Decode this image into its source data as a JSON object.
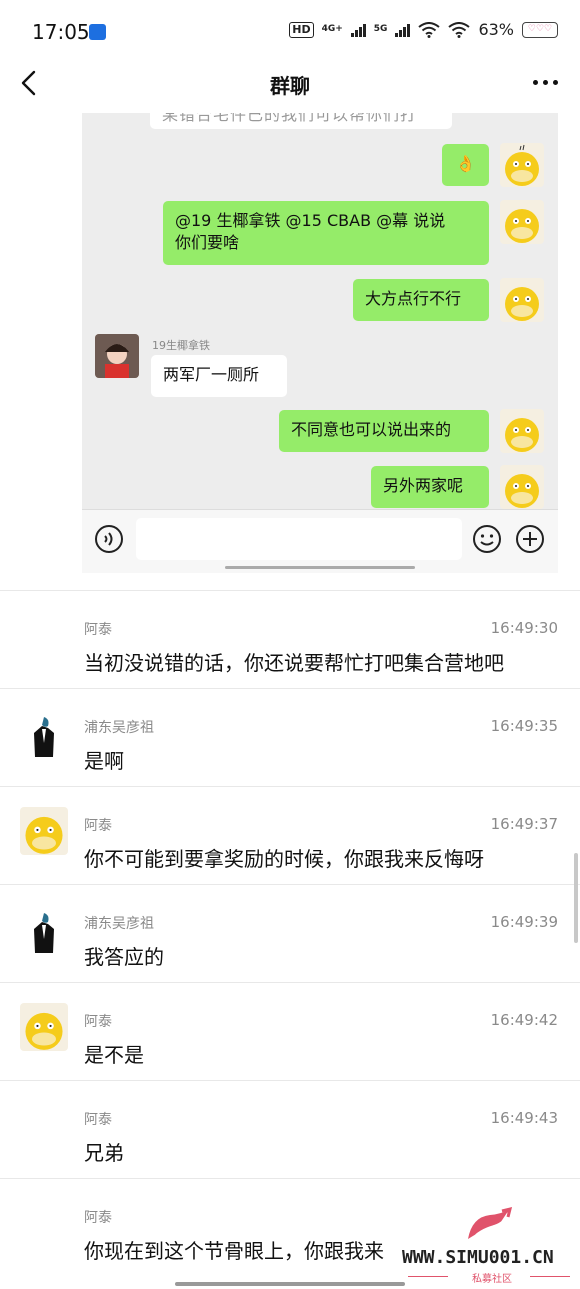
{
  "status_bar": {
    "time": "17:05",
    "hd": "HD",
    "net1": "4G+",
    "net2": "5G",
    "battery_pct": "63%",
    "battery_glyph": "♡♡♡"
  },
  "nav": {
    "title": "群聊"
  },
  "embedded_chat": {
    "cut_text": "某错合宅件已的我们可以帮你们打",
    "messages": [
      {
        "side": "right",
        "text": "👌"
      },
      {
        "side": "right",
        "text_line1": "@19 生椰拿铁  @15 CBAB @幕  说说",
        "text_line2": "你们要啥"
      },
      {
        "side": "right",
        "text": "大方点行不行"
      },
      {
        "side": "left",
        "sender": "19生椰拿铁",
        "text": "两军厂一厕所"
      },
      {
        "side": "right",
        "text": "不同意也可以说出来的"
      },
      {
        "side": "right",
        "text": "另外两家呢"
      }
    ]
  },
  "comments": [
    {
      "name": "阿泰",
      "time": "16:49:30",
      "text": "当初没说错的话，你还说要帮忙打吧集合营地吧",
      "avatar": "none"
    },
    {
      "name": "浦东吴彦祖",
      "time": "16:49:35",
      "text": " 是啊",
      "avatar": "suit"
    },
    {
      "name": "阿泰",
      "time": "16:49:37",
      "text": "你不可能到要拿奖励的时候，你跟我来反悔呀",
      "avatar": "duck"
    },
    {
      "name": "浦东吴彦祖",
      "time": "16:49:39",
      "text": "我答应的",
      "avatar": "suit"
    },
    {
      "name": "阿泰",
      "time": "16:49:42",
      "text": "是不是",
      "avatar": "duck"
    },
    {
      "name": "阿泰",
      "time": "16:49:43",
      "text": "兄弟",
      "avatar": "none"
    },
    {
      "name": "阿泰",
      "time": "",
      "text": "你现在到这个节骨眼上，你跟我来",
      "avatar": "none"
    }
  ],
  "watermark": {
    "text": "WWW.SIMU001.CN",
    "sub": "私募社区"
  },
  "colors": {
    "bubble_green": "#95ec69",
    "chat_bg": "#ededed",
    "watermark_red": "#e0536b"
  }
}
